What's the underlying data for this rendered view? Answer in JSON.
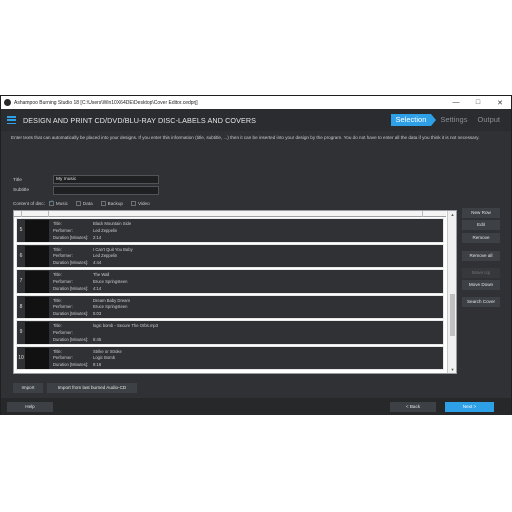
{
  "window": {
    "title": "Ashampoo Burning Studio 18 [C:\\Users\\Win10X64DE\\Desktop\\Cover Editor.cedprj]",
    "minimize": "—",
    "maximize": "□",
    "close": "✕"
  },
  "header": {
    "title": "DESIGN AND PRINT CD/DVD/BLU-RAY DISC-LABELS AND COVERS",
    "steps": [
      "Selection",
      "Settings",
      "Output"
    ]
  },
  "intro": "Enter texts that can automatically be placed into your designs. If you enter this information (title, subtitle, ...) then it can be inserted into your design by the program. You do not have to enter all the data if you think it is not necessary.",
  "form": {
    "title_label": "Title",
    "title_value": "My music",
    "subtitle_label": "Subtitle",
    "subtitle_value": "",
    "content_label": "Content of disc:",
    "options": [
      {
        "label": "Music",
        "checked": true
      },
      {
        "label": "Data",
        "checked": false
      },
      {
        "label": "Backup",
        "checked": false
      },
      {
        "label": "Video",
        "checked": false
      }
    ]
  },
  "field_keys": {
    "title": "Title:",
    "performer": "Performer:",
    "duration": "Duration [Minutes]:"
  },
  "tracks": [
    {
      "num": "5",
      "title": "Black Mountain Side",
      "performer": "Led Zeppelin",
      "duration": "2:14"
    },
    {
      "num": "6",
      "title": "I Can't Quit You Baby",
      "performer": "Led Zeppelin",
      "duration": "4:44"
    },
    {
      "num": "7",
      "title": "The Wall",
      "performer": "Bruce Springsteen",
      "duration": "4:14"
    },
    {
      "num": "8",
      "title": "Dream Baby Dream",
      "performer": "Bruce Springsteen",
      "duration": "5:03"
    },
    {
      "num": "9",
      "title": "logic bomb - Secure The Orbs.mp3",
      "performer": "",
      "duration": "8:45"
    },
    {
      "num": "10",
      "title": "Strike or Stroke",
      "performer": "Logic Bomb",
      "duration": "8:18"
    }
  ],
  "side_buttons": {
    "new_row": "New Row",
    "edit": "Edit",
    "remove": "Remove",
    "remove_all": "Remove all",
    "move_up": "Move Up",
    "move_down": "Move Down",
    "search_cover": "Search Cover"
  },
  "bottom": {
    "import": "Import",
    "import_last": "Import from last burned Audio-CD",
    "help": "Help",
    "back": "< Back",
    "next": "Next >"
  },
  "colors": {
    "accent": "#2ea0e8",
    "background": "#2f3134"
  }
}
